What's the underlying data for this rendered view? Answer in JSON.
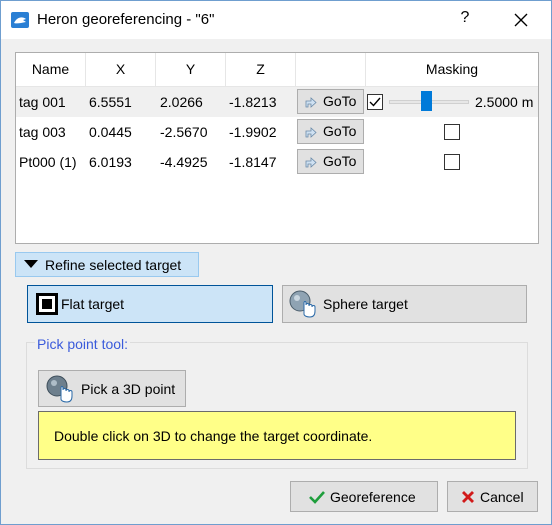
{
  "window": {
    "title": "Heron georeferencing - \"6\"",
    "help_label": "?"
  },
  "table": {
    "columns": [
      "Name",
      "X",
      "Y",
      "Z",
      "",
      "Masking"
    ],
    "rows": [
      {
        "name": "tag 001",
        "x": "6.5551",
        "y": "2.0266",
        "z": "-1.8213",
        "goto_label": "GoTo",
        "masked": true,
        "mask_value": "2.5000 m",
        "selected": true
      },
      {
        "name": "tag 003",
        "x": "0.0445",
        "y": "-2.5670",
        "z": "-1.9902",
        "goto_label": "GoTo",
        "masked": false
      },
      {
        "name": "Pt000 (1)",
        "x": "6.0193",
        "y": "-4.4925",
        "z": "-1.8147",
        "goto_label": "GoTo",
        "masked": false
      }
    ]
  },
  "refine": {
    "label": "Refine selected target",
    "expanded": true
  },
  "target_type": {
    "flat_label": "Flat target",
    "sphere_label": "Sphere target",
    "selected": "flat"
  },
  "pick_tool": {
    "group_title": "Pick point tool:",
    "button_label": "Pick a 3D point",
    "info_text": "Double click on 3D to change the target coordinate."
  },
  "footer": {
    "georeference_label": "Georeference",
    "cancel_label": "Cancel"
  },
  "colors": {
    "selection_blue": "#cce4f7",
    "accent": "#007ad9",
    "info_bg": "#ffff88",
    "ok_green": "#1e9e3c",
    "cancel_red": "#d11a1a"
  },
  "icons": {
    "app": "heron-app-icon",
    "goto": "goto-arrow-icon",
    "flat": "flat-target-icon",
    "sphere": "sphere-target-icon",
    "pick": "pick-point-icon",
    "check": "check-icon",
    "cancel": "cancel-x-icon"
  }
}
